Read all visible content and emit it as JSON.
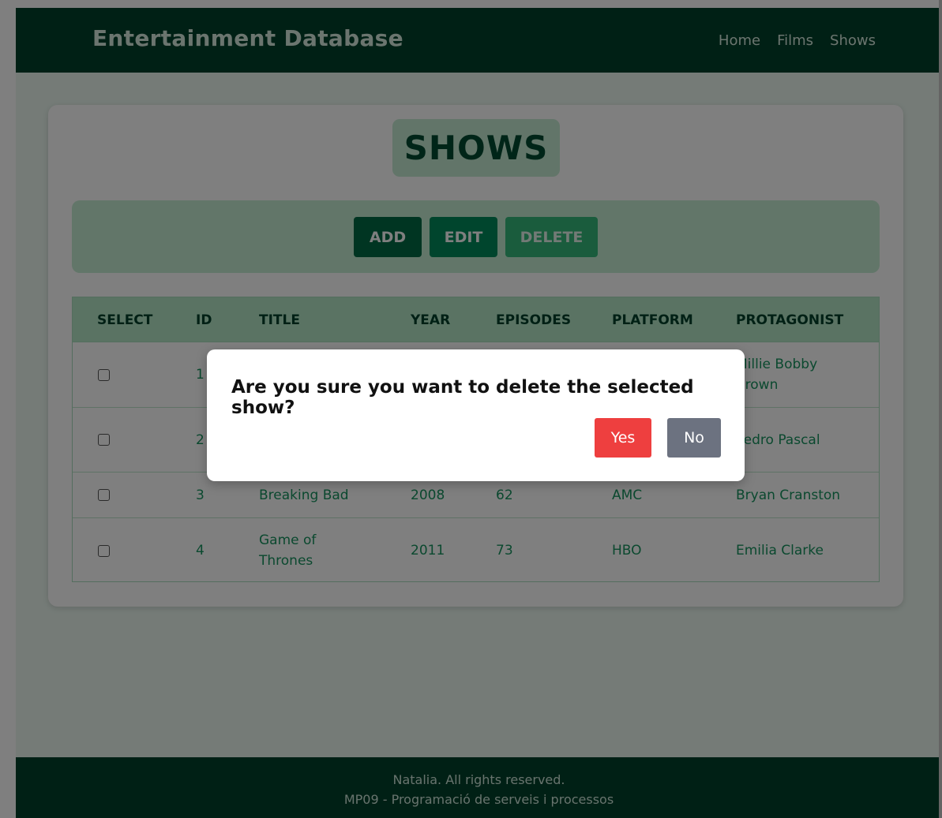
{
  "header": {
    "brand": "Entertainment Database",
    "nav": [
      "Home",
      "Films",
      "Shows"
    ]
  },
  "main": {
    "title": "SHOWS",
    "toolbar": {
      "add_label": "ADD",
      "edit_label": "EDIT",
      "delete_label": "DELETE"
    },
    "table": {
      "columns": [
        "SELECT",
        "ID",
        "TITLE",
        "YEAR",
        "EPISODES",
        "PLATFORM",
        "PROTAGONIST"
      ],
      "rows": [
        {
          "id": "1",
          "title": "",
          "year": "",
          "episodes": "",
          "platform": "",
          "protagonist": "Millie Bobby Brown"
        },
        {
          "id": "2",
          "title": "",
          "year": "",
          "episodes": "",
          "platform": "",
          "protagonist": "Pedro Pascal"
        },
        {
          "id": "3",
          "title": "Breaking Bad",
          "year": "2008",
          "episodes": "62",
          "platform": "AMC",
          "protagonist": "Bryan Cranston"
        },
        {
          "id": "4",
          "title": "Game of Thrones",
          "year": "2011",
          "episodes": "73",
          "platform": "HBO",
          "protagonist": "Emilia Clarke"
        }
      ]
    }
  },
  "modal": {
    "message": "Are you sure you want to delete the selected show?",
    "yes_label": "Yes",
    "no_label": "No"
  },
  "footer": {
    "line1": "Natalia. All rights reserved.",
    "line2": "MP09 - Programació de serveis i processos"
  },
  "colors": {
    "header_bg": "#00402a",
    "accent_green": "#006b45",
    "danger": "#ee3f3f",
    "neutral": "#6c7280"
  }
}
